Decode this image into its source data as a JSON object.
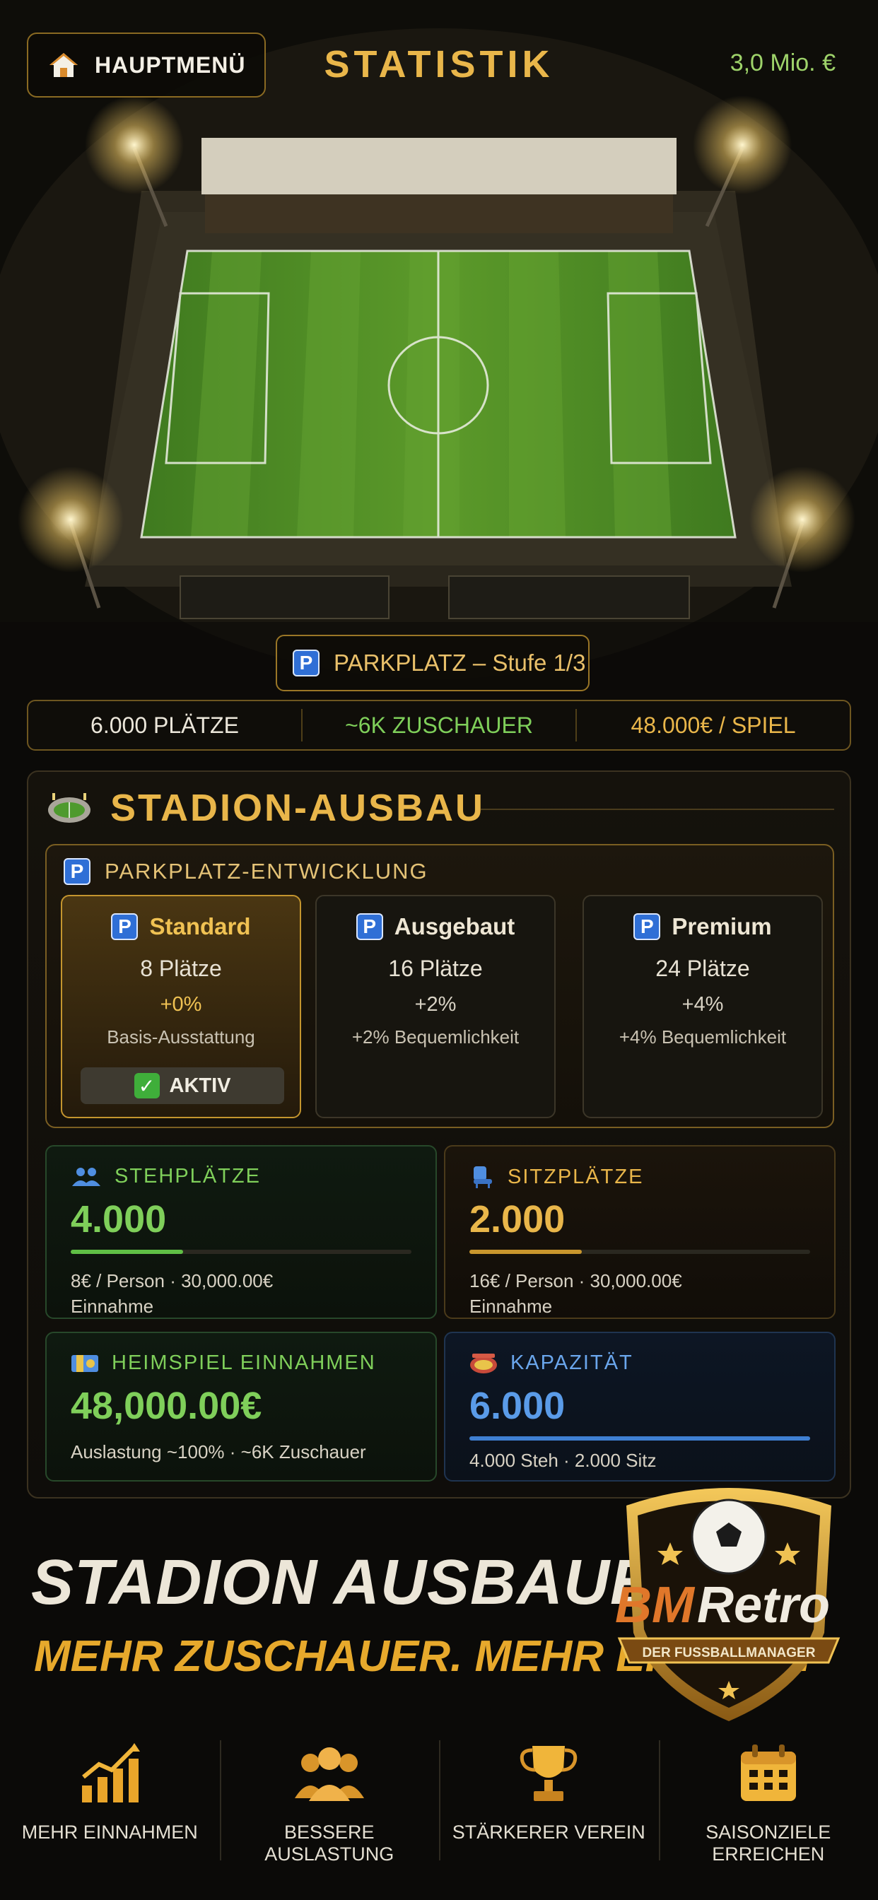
{
  "header": {
    "menu_label": "HAUPTMENÜ",
    "title": "STATISTIK",
    "budget": "3,0 Mio. €"
  },
  "hero": {
    "parking_label": "PARKPLATZ – Stufe 1/3"
  },
  "stats_strip": {
    "capacity": "6.000 PLÄTZE",
    "spectators": "~6K ZUSCHAUER",
    "income": "48.000€ / SPIEL"
  },
  "panel": {
    "title": "STADION-AUSBAU",
    "parking": {
      "title": "PARKPLATZ-ENTWICKLUNG",
      "options": [
        {
          "name": "Standard",
          "seats": "8 Plätze",
          "bonus": "+0%",
          "desc": "Basis-Ausstattung",
          "status": "AKTIV"
        },
        {
          "name": "Ausgebaut",
          "seats": "16 Plätze",
          "bonus": "+2%",
          "desc": "+2% Bequemlichkeit"
        },
        {
          "name": "Premium",
          "seats": "24 Plätze",
          "bonus": "+4%",
          "desc": "+4% Bequemlichkeit"
        }
      ]
    },
    "cards": {
      "standing": {
        "title": "STEHPLÄTZE",
        "value": "4.000",
        "line1": "8€ / Person  ·  30,000.00€",
        "line2": "Einnahme",
        "fill": 0.33
      },
      "seating": {
        "title": "SITZPLÄTZE",
        "value": "2.000",
        "line1": "16€ / Person  ·  30,000.00€",
        "line2": "Einnahme",
        "fill": 0.33
      },
      "income": {
        "title": "HEIMSPIEL EINNAHMEN",
        "value": "48,000.00€",
        "line1": "Auslastung ~100%  ·  ~6K Zuschauer"
      },
      "capacity": {
        "title": "KAPAZITÄT",
        "value": "6.000",
        "line1": "4.000 Steh  ·  2.000 Sitz",
        "fill": 1.0
      }
    }
  },
  "promo": {
    "line1": "STADION AUSBAUEN.",
    "line2": "MEHR ZUSCHAUER. MEHR ERFOLG."
  },
  "logo": {
    "bm": "BM",
    "retro": "Retro",
    "subtitle": "DER FUSSBALLMANAGER"
  },
  "features": [
    {
      "label": "MEHR EINNAHMEN",
      "icon": "chart-up-icon"
    },
    {
      "label": "BESSERE AUSLASTUNG",
      "icon": "people-icon"
    },
    {
      "label": "STÄRKERER VEREIN",
      "icon": "trophy-icon"
    },
    {
      "label": "SAISONZIELE ERREICHEN",
      "icon": "calendar-icon"
    }
  ],
  "colors": {
    "gold": "#e9b64a",
    "green": "#7fcf5a",
    "blue": "#5a9be8",
    "background": "#0b0a08"
  }
}
